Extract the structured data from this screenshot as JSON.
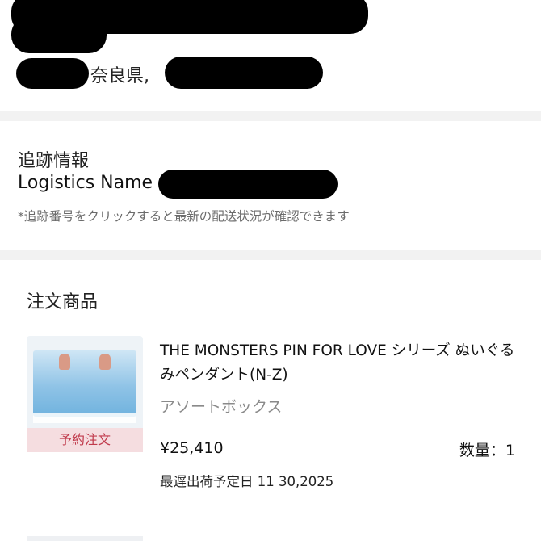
{
  "address": {
    "prefecture": "奈良県,"
  },
  "tracking": {
    "title": "追跡情報",
    "logistics_label": "Logistics Name",
    "note": "*追跡番号をクリックすると最新の配送状況が確認できます"
  },
  "order": {
    "section_title": "注文商品",
    "item": {
      "name": "THE MONSTERS PIN FOR LOVE シリーズ ぬいぐるみペンダント(N-Z)",
      "variant": "アソートボックス",
      "badge": "予約注文",
      "price": "¥25,410",
      "quantity": "数量：1",
      "ship_date": "最遅出荷予定日 11 30,2025"
    }
  },
  "colors": {
    "background": "#f2f2f2",
    "card": "#ffffff",
    "badge_bg": "#f5dde0",
    "badge_text": "#c0394b",
    "muted_text": "#8a8a8a"
  }
}
